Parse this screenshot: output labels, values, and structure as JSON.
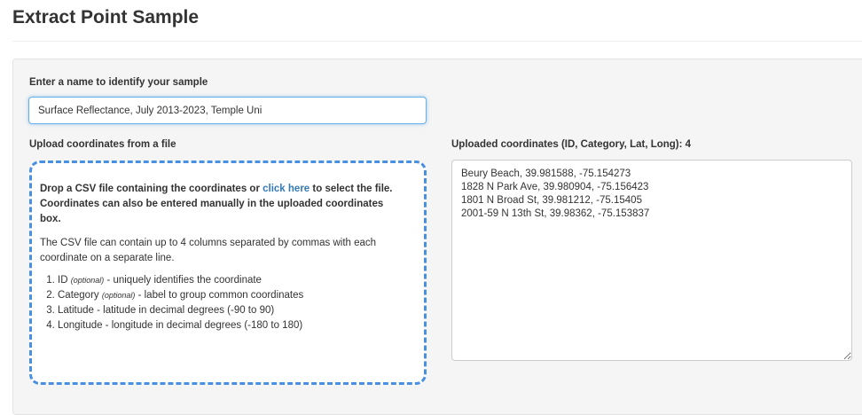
{
  "page": {
    "title": "Extract Point Sample"
  },
  "form": {
    "name_label": "Enter a name to identify your sample",
    "name_value": "Surface Reflectance, July 2013-2023, Temple Uni",
    "upload_label": "Upload coordinates from a file",
    "coords_label": "Uploaded coordinates (ID, Category, Lat, Long): 4"
  },
  "dropzone": {
    "lead_before": "Drop a CSV file containing the coordinates or ",
    "lead_link": "click here",
    "lead_after": " to select the file. Coordinates can also be entered manually in the uploaded coordinates box.",
    "description": "The CSV file can contain up to 4 columns separated by commas with each coordinate on a separate line.",
    "columns": [
      {
        "name": "ID",
        "optional": "(optional)",
        "desc": " - uniquely identifies the coordinate"
      },
      {
        "name": "Category",
        "optional": "(optional)",
        "desc": " - label to group common coordinates"
      },
      {
        "name": "Latitude",
        "optional": "",
        "desc": " - latitude in decimal degrees (-90 to 90)"
      },
      {
        "name": "Longitude",
        "optional": "",
        "desc": " - longitude in decimal degrees (-180 to 180)"
      }
    ]
  },
  "coordinates": {
    "text": "Beury Beach, 39.981588, -75.154273\n1828 N Park Ave, 39.980904, -75.156423\n1801 N Broad St, 39.981212, -75.15405\n2001-59 N 13th St, 39.98362, -75.153837"
  }
}
